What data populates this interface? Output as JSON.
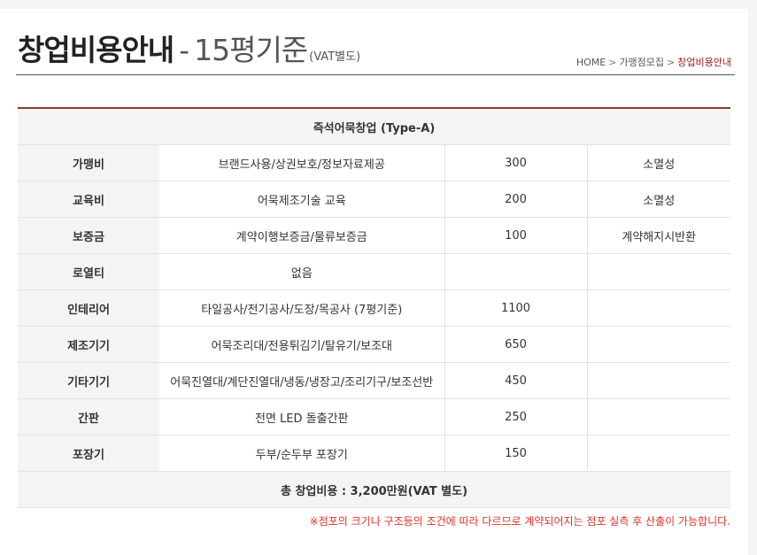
{
  "header": {
    "title_main": "창업비용안내",
    "title_separator": "-",
    "title_sub": "15평기준",
    "title_note": "(VAT별도)"
  },
  "breadcrumb": {
    "items": [
      "HOME",
      "가맹점모집",
      "창업비용안내"
    ]
  },
  "table": {
    "caption": "즉석어묵창업 (Type-A)",
    "rows": [
      {
        "label": "가맹비",
        "desc": "브랜드사용/상권보호/정보자료제공",
        "amount": "300",
        "note": "소멸성"
      },
      {
        "label": "교육비",
        "desc": "어묵제조기술 교육",
        "amount": "200",
        "note": "소멸성"
      },
      {
        "label": "보증금",
        "desc": "계약이행보증금/물류보증금",
        "amount": "100",
        "note": "계약해지시반환"
      },
      {
        "label": "로열티",
        "desc": "없음",
        "amount": "",
        "note": ""
      },
      {
        "label": "인테리어",
        "desc": "타일공사/전기공사/도장/목공사 (7평기준)",
        "amount": "1100",
        "note": ""
      },
      {
        "label": "제조기기",
        "desc": "어묵조리대/전용튀김기/탈유기/보조대",
        "amount": "650",
        "note": ""
      },
      {
        "label": "기타기기",
        "desc": "어묵진열대/계단진열대/냉동/냉장고/조리기구/보조선반",
        "amount": "450",
        "note": ""
      },
      {
        "label": "간판",
        "desc": "전면 LED 돌출간판",
        "amount": "250",
        "note": ""
      },
      {
        "label": "포장기",
        "desc": "두부/순두부 포장기",
        "amount": "150",
        "note": ""
      }
    ],
    "total": "총 창업비용 : 3,200만원(VAT 별도)"
  },
  "footnote": "※점포의 크기나 구조등의 조건에 따라 다르므로 계약되어지는 점포 실측 후 산출이 가능합니다.",
  "colors": {
    "table_top_border": "#8b3a2a",
    "breadcrumb_current": "#9b1c1c",
    "footnote": "#d9342b",
    "cell_shade": "#f4f4f4"
  }
}
